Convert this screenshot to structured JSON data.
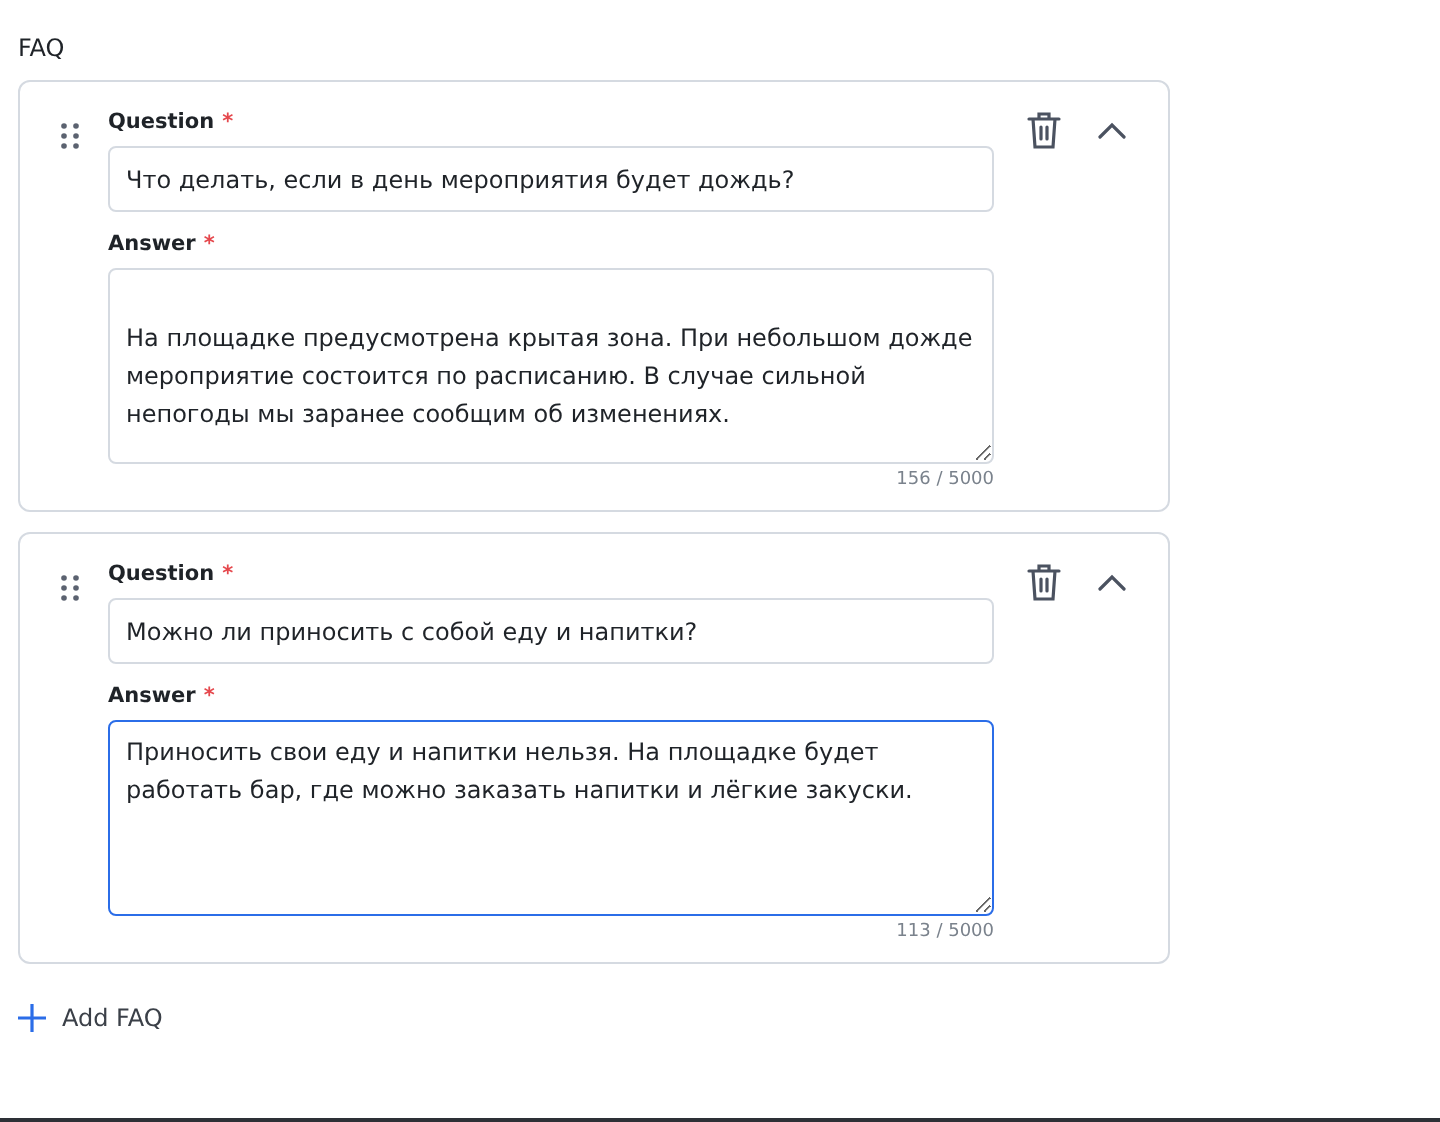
{
  "section_title": "FAQ",
  "items": [
    {
      "question_label": "Question",
      "question_required_mark": "*",
      "question": "Что делать, если в день мероприятия будет дождь?",
      "answer_label": "Answer",
      "answer_required_mark": "*",
      "answer": "\nНа площадке предусмотрена крытая зона. При небольшом дожде мероприятие состоится по расписанию. В случае сильной непогоды мы заранее сообщим об изменениях.",
      "answer_focused": false,
      "counter": "156 / 5000",
      "expanded": true
    },
    {
      "question_label": "Question",
      "question_required_mark": "*",
      "question": "Можно ли приносить с собой еду и напитки?",
      "answer_label": "Answer",
      "answer_required_mark": "*",
      "answer": "Приносить свои еду и напитки нельзя. На площадке будет работать бар, где можно заказать напитки и лёгкие закуски.",
      "answer_focused": true,
      "counter": "113 / 5000",
      "expanded": true
    }
  ],
  "add_button": "Add FAQ"
}
